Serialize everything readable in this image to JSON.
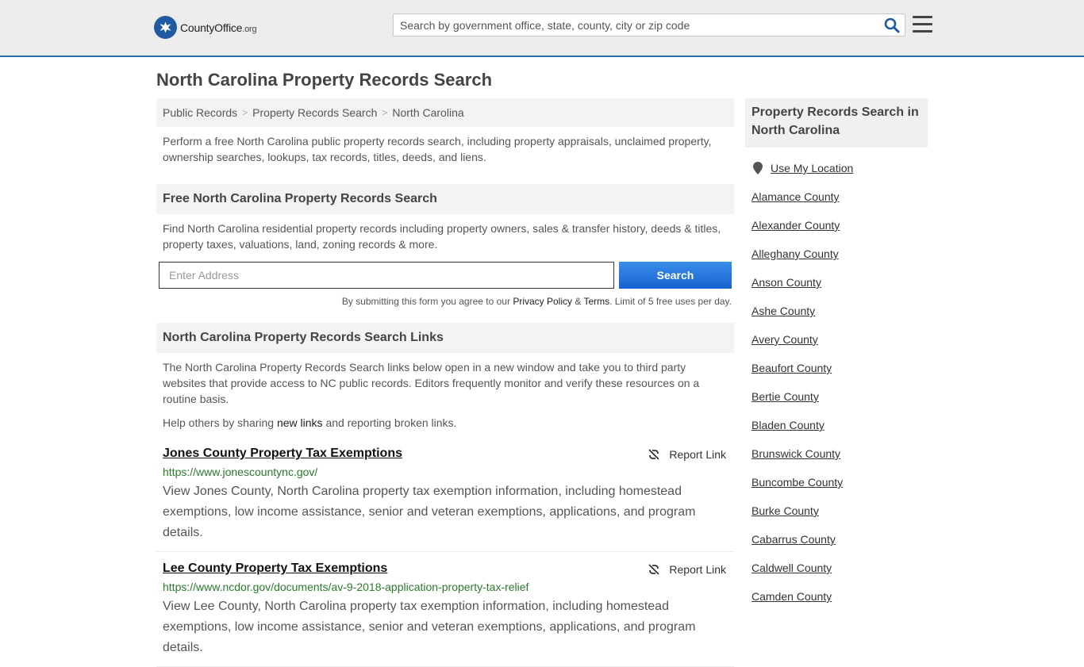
{
  "header": {
    "logo_text": "CountyOffice",
    "logo_suffix": ".org",
    "search_placeholder": "Search by government office, state, county, city or zip code"
  },
  "page_title": "North Carolina Property Records Search",
  "breadcrumb": [
    "Public Records",
    "Property Records Search",
    "North Carolina"
  ],
  "intro": "Perform a free North Carolina public property records search, including property appraisals, unclaimed property, ownership searches, lookups, tax records, titles, deeds, and liens.",
  "free_search": {
    "heading": "Free North Carolina Property Records Search",
    "description": "Find North Carolina residential property records including property owners, sales & transfer history, deeds & titles, property taxes, valuations, land, zoning records & more.",
    "address_placeholder": "Enter Address",
    "button_label": "Search",
    "terms_prefix": "By submitting this form you agree to our ",
    "privacy_label": "Privacy Policy",
    "terms_amp": " & ",
    "terms_label": "Terms",
    "terms_suffix": ". Limit of 5 free uses per day."
  },
  "links_section": {
    "heading": "North Carolina Property Records Search Links",
    "description": "The North Carolina Property Records Search links below open in a new window and take you to third party websites that provide access to NC public records. Editors frequently monitor and verify these resources on a routine basis.",
    "help_prefix": "Help others by sharing ",
    "help_link": "new links",
    "help_suffix": " and reporting broken links.",
    "report_label": "Report Link",
    "items": [
      {
        "title": "Jones County Property Tax Exemptions",
        "url": "https://www.jonescountync.gov/",
        "description": "View Jones County, North Carolina property tax exemption information, including homestead exemptions, low income assistance, senior and veteran exemptions, applications, and program details."
      },
      {
        "title": "Lee County Property Tax Exemptions",
        "url": "https://www.ncdor.gov/documents/av-9-2018-application-property-tax-relief",
        "description": "View Lee County, North Carolina property tax exemption information, including homestead exemptions, low income assistance, senior and veteran exemptions, applications, and program details."
      }
    ]
  },
  "sidebar": {
    "heading": "Property Records Search in North Carolina",
    "use_location": "Use My Location",
    "counties": [
      "Alamance County",
      "Alexander County",
      "Alleghany County",
      "Anson County",
      "Ashe County",
      "Avery County",
      "Beaufort County",
      "Bertie County",
      "Bladen County",
      "Brunswick County",
      "Buncombe County",
      "Burke County",
      "Cabarrus County",
      "Caldwell County",
      "Camden County"
    ]
  },
  "colors": {
    "accent": "#1f5aa0",
    "button": "#1462d0",
    "url_green": "#2b7a2b"
  }
}
